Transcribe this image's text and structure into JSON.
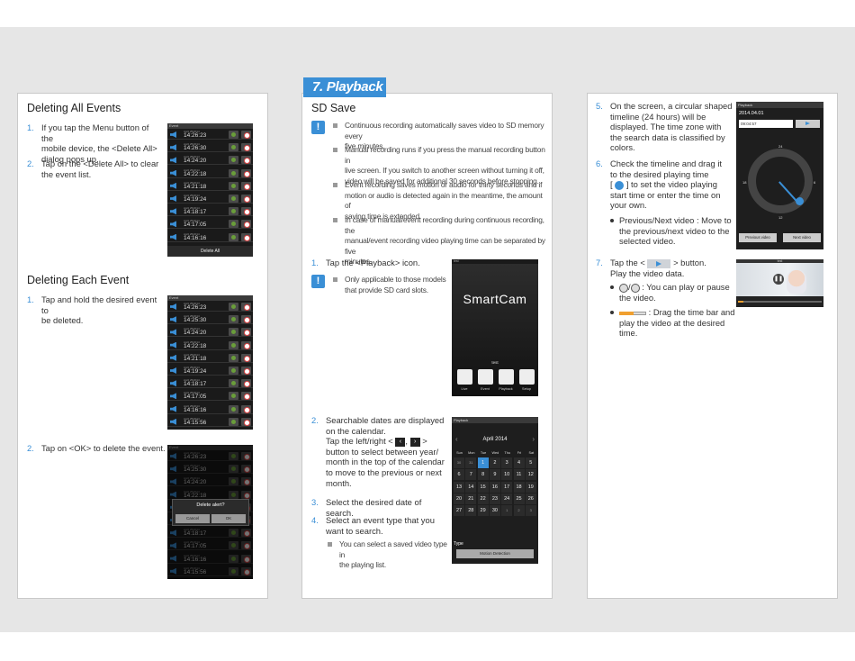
{
  "tab_title": "7. Playback",
  "left": {
    "section1_title": "Deleting All Events",
    "s1_step1_num": "1.",
    "s1_step1_lines": [
      "If you tap the Menu button of the",
      "mobile device, the <Delete All>",
      "dialog pops up."
    ],
    "s1_step2_num": "2.",
    "s1_step2_lines": [
      "Tap on the <Delete All> to clear",
      "the event list."
    ],
    "section2_title": "Deleting Each Event",
    "s2_step1_num": "1.",
    "s2_step1_lines": [
      "Tap and hold the desired event to",
      "be deleted."
    ],
    "s2_step2_num": "2.",
    "s2_step2_text": "Tap on <OK> to delete the event.",
    "phone_header": "Event",
    "delete_all_label": "Delete All",
    "event_date": "April 25/2014",
    "events_a": [
      "14:26:23",
      "14:26:30",
      "14:24:20",
      "14:22:18",
      "14:21:18",
      "14:19:24",
      "14:18:17",
      "14:17:05",
      "14:16:16",
      "14:15:56"
    ],
    "events_b": [
      "14:26:23",
      "14:25:30",
      "14:24:20",
      "14:22:18",
      "14:21:18",
      "14:19:24",
      "14:18:17",
      "14:17:05",
      "14:16:16",
      "14:15:56"
    ],
    "dialog_question": "Delete alert?",
    "dialog_cancel": "Cancel",
    "dialog_ok": "OK"
  },
  "middle": {
    "title": "SD Save",
    "notes": [
      [
        "Continuous recording automatically saves video to SD memory every",
        "five minutes."
      ],
      [
        "Manual recording runs if you press the manual recording button in",
        "live screen. If you switch to another screen without turning it off,",
        "video will be saved for additional 30 seconds before stopping."
      ],
      [
        "Event recording saves motion or audio for thirty seconds and if",
        "motion or audio is detected again in the meantime, the amount of",
        "saving time is extended."
      ],
      [
        "In case of manual/event recording during continuous recording, the",
        "manual/event recording video playing time can be separated by five",
        "minutes."
      ]
    ],
    "step1_num": "1.",
    "step1_text": "Tap the <Playback> icon.",
    "step1_note": [
      "Only applicable to those models",
      "that provide SD card slots."
    ],
    "step2_num": "2.",
    "step2_lines": [
      "Searchable dates are displayed",
      "on the calendar.",
      "Tap the left/right <",
      "button to select between year/",
      "month in the top of the calendar",
      "to move to the previous or next",
      "month."
    ],
    "step3_num": "3.",
    "step3_text": "Select the desired date of search.",
    "step4_num": "4.",
    "step4_lines": [
      "Select an event type that you",
      "want to search."
    ],
    "step4_note": [
      "You can select a saved video type in",
      "the playing list."
    ],
    "app_name": "SmartCam",
    "device_name": "test",
    "app_icons": [
      "Live",
      "Event",
      "Playback",
      "Setup"
    ],
    "cal_header": "Playback",
    "cal_month": "April 2014",
    "cal_weekdays": [
      "Sun",
      "Mon",
      "Tue",
      "Wed",
      "Thu",
      "Fri",
      "Sat"
    ],
    "cal_days": [
      "30",
      "31",
      "1",
      "2",
      "3",
      "4",
      "5",
      "6",
      "7",
      "8",
      "9",
      "10",
      "11",
      "12",
      "13",
      "14",
      "15",
      "16",
      "17",
      "18",
      "19",
      "20",
      "21",
      "22",
      "23",
      "24",
      "25",
      "26",
      "27",
      "28",
      "29",
      "30",
      "1",
      "2",
      "3"
    ],
    "cal_type_label": "Type",
    "cal_type_value": "Motion Detection"
  },
  "right": {
    "step5_num": "5.",
    "step5_lines": [
      "On the screen, a circular shaped",
      "timeline (24 hours) will be",
      "displayed. The time zone with",
      "the search data is classified by",
      "colors."
    ],
    "step6_num": "6.",
    "step6_lines": [
      "Check the timeline and drag it",
      "to the desired playing time",
      "] to set the video playing",
      "start time or enter the time on",
      "your own."
    ],
    "step6_bullet": [
      "Previous/Next video : Move to",
      "the previous/next video to the",
      "selected video."
    ],
    "step7_num": "7.",
    "step7_lines": [
      "Tap the <",
      "> button.",
      "Play the video data."
    ],
    "step7_b1": [
      "/",
      " : You can play or pause",
      "the video."
    ],
    "step7_b2": [
      " : Drag the time bar and",
      "play the video at the desired time."
    ],
    "tl_header": "Playback",
    "tl_date": "2014.04.01",
    "tl_time": "09:04:57",
    "tl_numbers": [
      "24",
      "6",
      "12",
      "18"
    ],
    "tl_prev": "Previous video",
    "tl_next": "Next video",
    "vid_header": "test"
  },
  "colors": {
    "accent": "#3a8fd6",
    "band": "#e6e6e6"
  }
}
